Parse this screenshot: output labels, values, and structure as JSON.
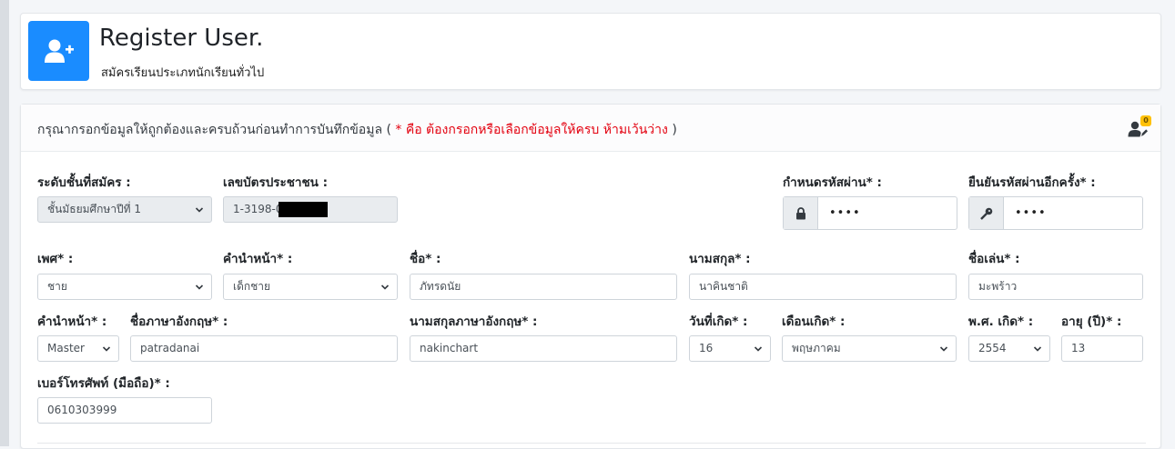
{
  "header": {
    "title": "Register User.",
    "subtitle": "สมัครเรียนประเภทนักเรียนทั่วไป",
    "icon": "user-plus-icon",
    "icon_bg": "#1a8cff"
  },
  "notice": {
    "prefix": "กรุณากรอกข้อมูลให้ถูกต้องและครบถ้วนก่อนทำการบันทึกข้อมูล (",
    "required_note": " * คือ ต้องกรอกหรือเลือกข้อมูลให้ครบ ห้ามเว้นว่าง ",
    "suffix": ")",
    "required_color": "#e3000f",
    "badge_count": "0",
    "icon": "user-edit-icon"
  },
  "form": {
    "level": {
      "label": "ระดับชั้นที่สมัคร :",
      "value": "ชั้นมัธยมศึกษาปีที่ 1"
    },
    "id_card": {
      "label": "เลขบัตรประชาชน :",
      "value": "1-3198-005"
    },
    "password": {
      "label": "กำหนดรหัสผ่าน* :",
      "value": "••••",
      "icon": "lock-icon"
    },
    "confirm_password": {
      "label": "ยืนยันรหัสผ่านอีกครั้ง* :",
      "value": "••••",
      "icon": "key-icon"
    },
    "gender": {
      "label": "เพศ* :",
      "value": "ชาย"
    },
    "prefix_th": {
      "label": "คำนำหน้า* :",
      "value": "เด็กชาย"
    },
    "first_name": {
      "label": "ชื่อ* :",
      "value": "ภัทรดนัย"
    },
    "last_name": {
      "label": "นามสกุล* :",
      "value": "นาคินชาติ"
    },
    "nickname": {
      "label": "ชื่อเล่น* :",
      "value": "มะพร้าว"
    },
    "prefix_en": {
      "label": "คำนำหน้า* :",
      "value": "Master"
    },
    "first_name_en": {
      "label": "ชื่อภาษาอังกฤษ* :",
      "value": "patradanai"
    },
    "last_name_en": {
      "label": "นามสกุลภาษาอังกฤษ* :",
      "value": "nakinchart"
    },
    "birth_day": {
      "label": "วันที่เกิด* :",
      "value": "16"
    },
    "birth_month": {
      "label": "เดือนเกิด* :",
      "value": "พฤษภาคม"
    },
    "birth_year": {
      "label": "พ.ศ. เกิด* :",
      "value": "2554"
    },
    "age": {
      "label": "อายุ (ปี)* :",
      "value": "13"
    },
    "phone": {
      "label": "เบอร์โทรศัพท์ (มือถือ)* :",
      "value": "0610303999"
    }
  }
}
